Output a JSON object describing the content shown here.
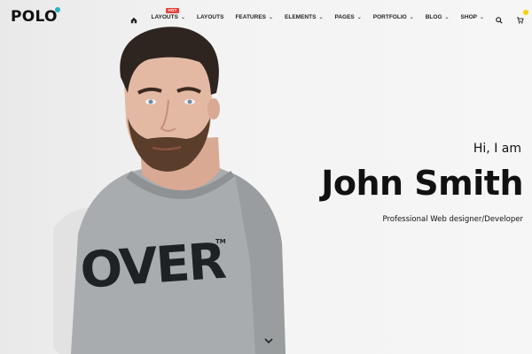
{
  "brand": {
    "logo": "POLO"
  },
  "nav": {
    "items": [
      {
        "label": "LAYOUTS",
        "badge": "HOT",
        "has_dropdown": true
      },
      {
        "label": "LAYOUTS",
        "has_dropdown": false
      },
      {
        "label": "FEATURES",
        "has_dropdown": true
      },
      {
        "label": "ELEMENTS",
        "has_dropdown": true
      },
      {
        "label": "PAGES",
        "has_dropdown": true
      },
      {
        "label": "PORTFOLIO",
        "has_dropdown": true
      },
      {
        "label": "BLOG",
        "has_dropdown": true
      },
      {
        "label": "SHOP",
        "has_dropdown": true
      }
    ],
    "icons": {
      "home": "home-icon",
      "search": "search-icon",
      "cart": "cart-icon"
    }
  },
  "hero": {
    "greeting": "Hi, I am",
    "name": "John Smith",
    "subtitle": "Professional Web designer/Developer",
    "shirt_text": "OVER",
    "shirt_tm": "TM"
  },
  "colors": {
    "accent": "#2bb3c0",
    "hot_badge": "#e8413a",
    "cart_badge": "#f5d20b",
    "text": "#111111"
  }
}
